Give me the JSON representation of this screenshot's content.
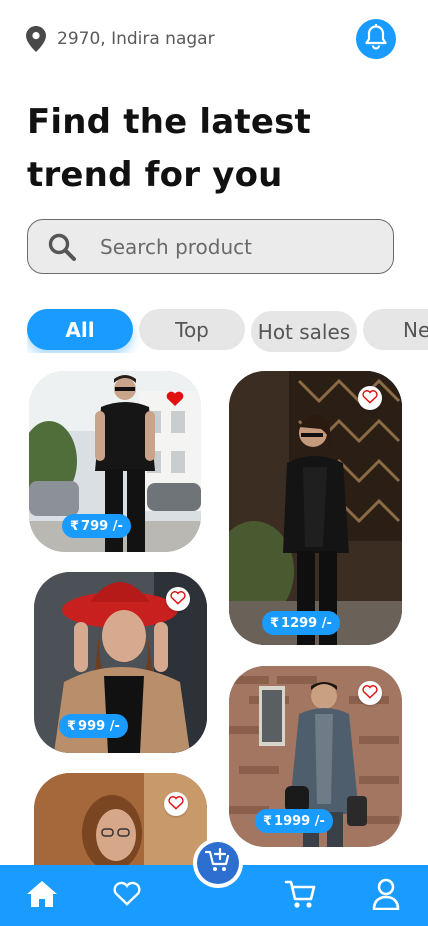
{
  "header": {
    "location_icon": "location-pin-icon",
    "address": "2970, Indira nagar",
    "notification_icon": "bell-icon"
  },
  "headline": {
    "line1": "Find the latest",
    "line2": "trend for you"
  },
  "search": {
    "icon": "search-icon",
    "placeholder": "Search product"
  },
  "categories": [
    {
      "label": "All",
      "active": true
    },
    {
      "label": "Top",
      "active": false
    },
    {
      "label": "Hot sales",
      "active": false
    },
    {
      "label": "Ne",
      "active": false
    }
  ],
  "products": [
    {
      "currency": "₹",
      "price": "799 /-",
      "favorited": true
    },
    {
      "currency": "₹",
      "price": "1299 /-",
      "favorited": false
    },
    {
      "currency": "₹",
      "price": "999 /-",
      "favorited": false
    },
    {
      "currency": "₹",
      "price": "1999 /-",
      "favorited": false
    },
    {
      "currency": "₹",
      "price": "",
      "favorited": false
    }
  ],
  "nav": {
    "items": [
      "home-icon",
      "heart-icon",
      "add-to-cart-icon",
      "cart-icon",
      "user-icon"
    ]
  },
  "colors": {
    "accent": "#1a9bff",
    "center_button": "#2c6fd0",
    "favorite_red": "#e01010"
  }
}
